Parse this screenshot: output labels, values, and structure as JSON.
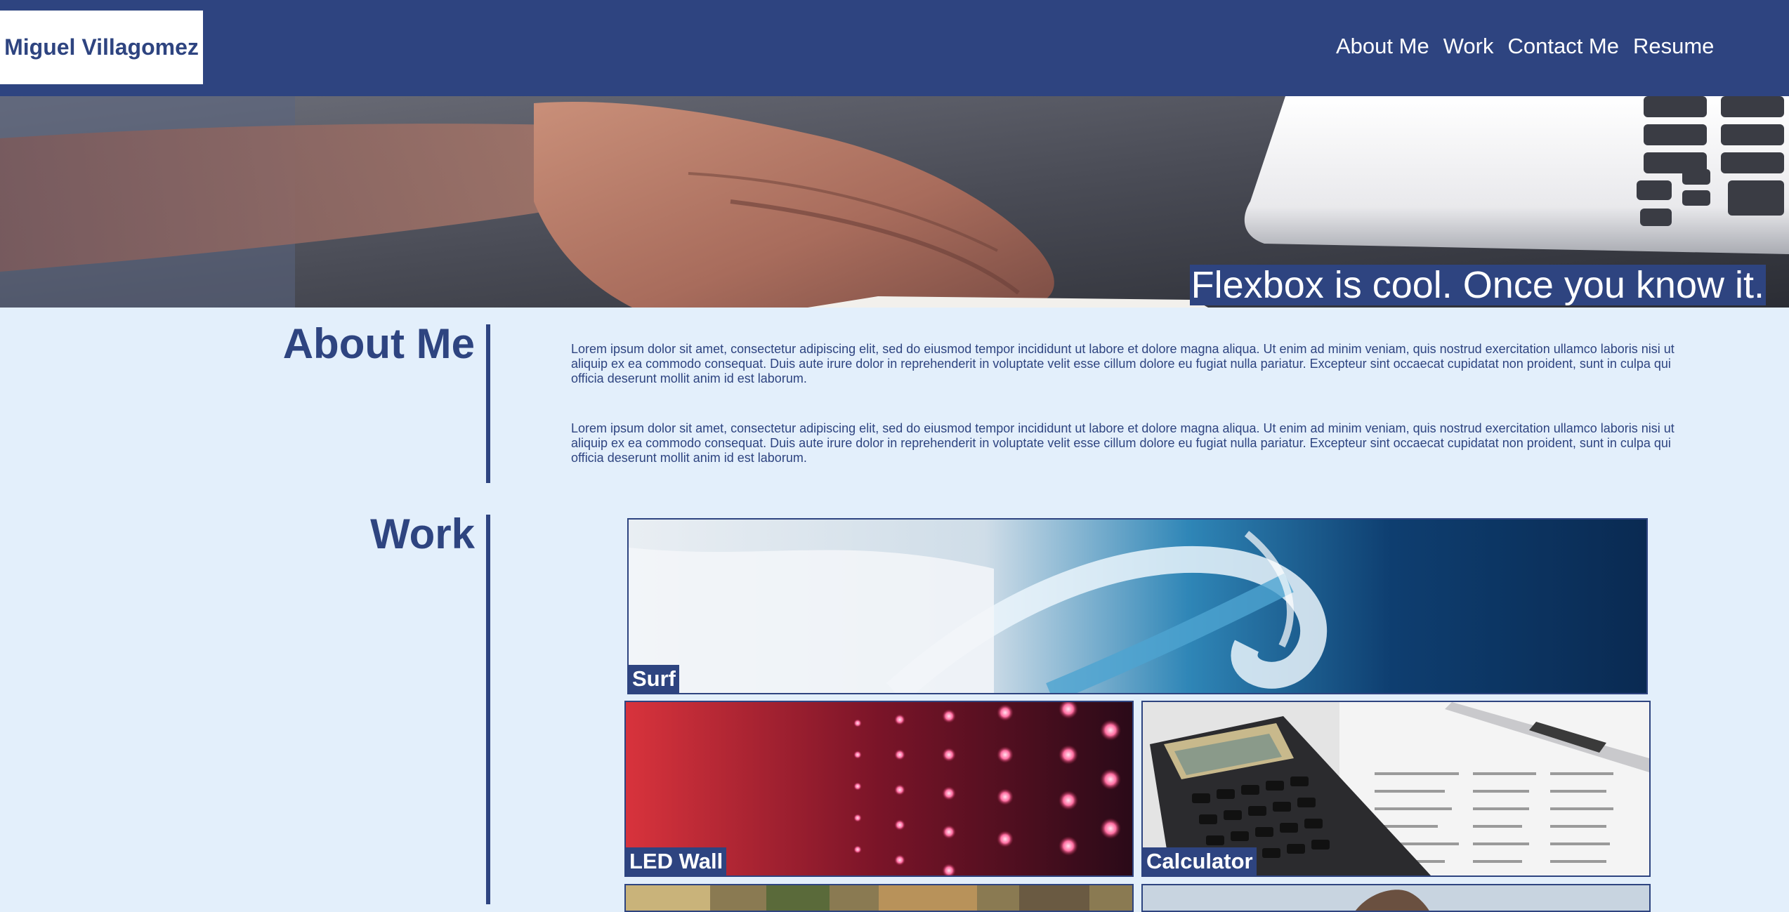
{
  "site": {
    "logo": "Miguel Villagomez"
  },
  "nav": {
    "items": [
      {
        "label": "About Me"
      },
      {
        "label": "Work"
      },
      {
        "label": "Contact Me"
      },
      {
        "label": "Resume"
      }
    ]
  },
  "hero": {
    "caption": "Flexbox is cool. Once you know it."
  },
  "about": {
    "heading": "About Me",
    "paragraphs": [
      "Lorem ipsum dolor sit amet, consectetur adipiscing elit, sed do eiusmod tempor incididunt ut labore et dolore magna aliqua. Ut enim ad minim veniam, quis nostrud exercitation ullamco laboris nisi ut aliquip ex ea commodo consequat. Duis aute irure dolor in reprehenderit in voluptate velit esse cillum dolore eu fugiat nulla pariatur. Excepteur sint occaecat cupidatat non proident, sunt in culpa qui officia deserunt mollit anim id est laborum.",
      "Lorem ipsum dolor sit amet, consectetur adipiscing elit, sed do eiusmod tempor incididunt ut labore et dolore magna aliqua. Ut enim ad minim veniam, quis nostrud exercitation ullamco laboris nisi ut aliquip ex ea commodo consequat. Duis aute irure dolor in reprehenderit in voluptate velit esse cillum dolore eu fugiat nulla pariatur. Excepteur sint occaecat cupidatat non proident, sunt in culpa qui officia deserunt mollit anim id est laborum."
    ]
  },
  "work": {
    "heading": "Work",
    "tiles": [
      {
        "label": "Surf"
      },
      {
        "label": "LED Wall"
      },
      {
        "label": "Calculator"
      }
    ]
  },
  "colors": {
    "brand": "#2e4480",
    "page_background": "#e3effb",
    "header_text": "#ffffff"
  }
}
